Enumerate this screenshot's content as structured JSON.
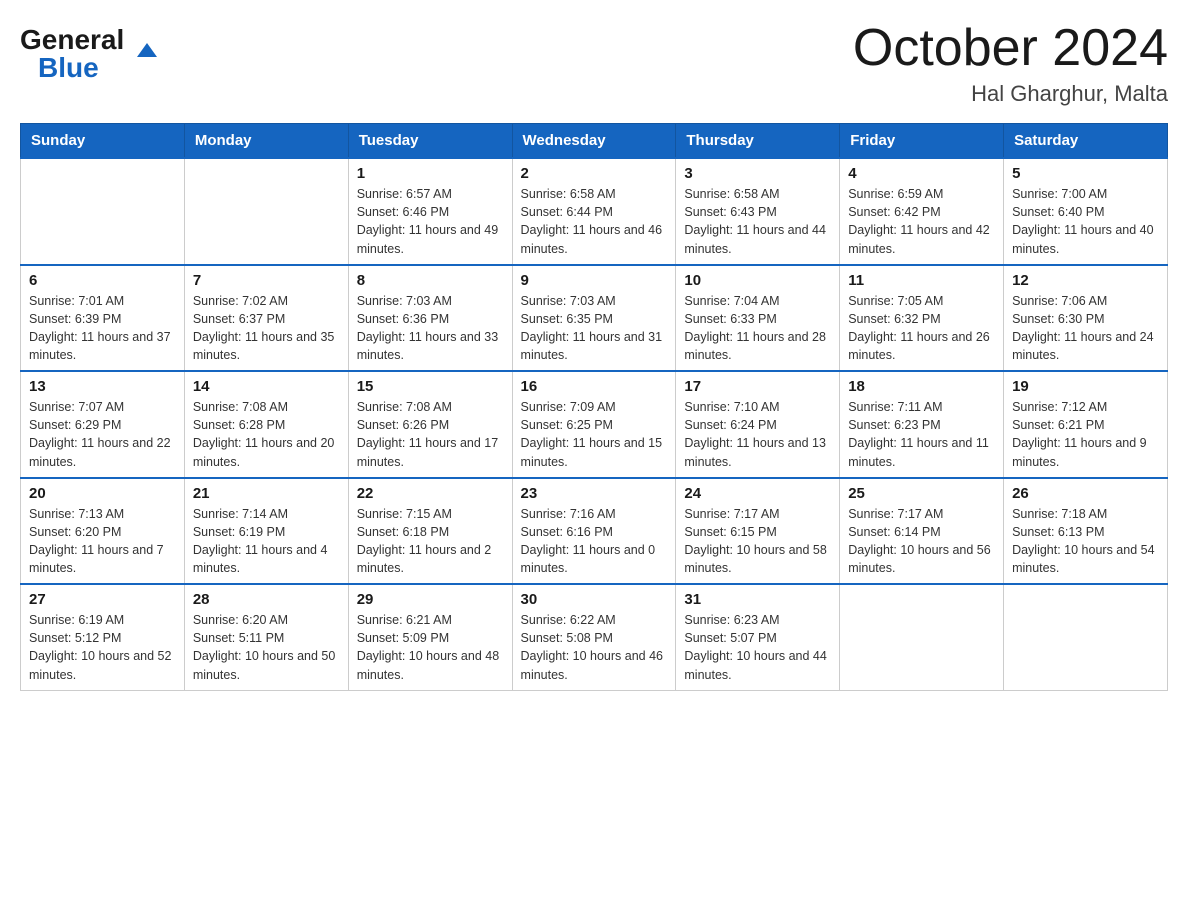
{
  "header": {
    "logo_general": "General",
    "logo_blue": "Blue",
    "month_year": "October 2024",
    "location": "Hal Gharghur, Malta"
  },
  "days_of_week": [
    "Sunday",
    "Monday",
    "Tuesday",
    "Wednesday",
    "Thursday",
    "Friday",
    "Saturday"
  ],
  "weeks": [
    [
      {
        "day": "",
        "sunrise": "",
        "sunset": "",
        "daylight": ""
      },
      {
        "day": "",
        "sunrise": "",
        "sunset": "",
        "daylight": ""
      },
      {
        "day": "1",
        "sunrise": "Sunrise: 6:57 AM",
        "sunset": "Sunset: 6:46 PM",
        "daylight": "Daylight: 11 hours and 49 minutes."
      },
      {
        "day": "2",
        "sunrise": "Sunrise: 6:58 AM",
        "sunset": "Sunset: 6:44 PM",
        "daylight": "Daylight: 11 hours and 46 minutes."
      },
      {
        "day": "3",
        "sunrise": "Sunrise: 6:58 AM",
        "sunset": "Sunset: 6:43 PM",
        "daylight": "Daylight: 11 hours and 44 minutes."
      },
      {
        "day": "4",
        "sunrise": "Sunrise: 6:59 AM",
        "sunset": "Sunset: 6:42 PM",
        "daylight": "Daylight: 11 hours and 42 minutes."
      },
      {
        "day": "5",
        "sunrise": "Sunrise: 7:00 AM",
        "sunset": "Sunset: 6:40 PM",
        "daylight": "Daylight: 11 hours and 40 minutes."
      }
    ],
    [
      {
        "day": "6",
        "sunrise": "Sunrise: 7:01 AM",
        "sunset": "Sunset: 6:39 PM",
        "daylight": "Daylight: 11 hours and 37 minutes."
      },
      {
        "day": "7",
        "sunrise": "Sunrise: 7:02 AM",
        "sunset": "Sunset: 6:37 PM",
        "daylight": "Daylight: 11 hours and 35 minutes."
      },
      {
        "day": "8",
        "sunrise": "Sunrise: 7:03 AM",
        "sunset": "Sunset: 6:36 PM",
        "daylight": "Daylight: 11 hours and 33 minutes."
      },
      {
        "day": "9",
        "sunrise": "Sunrise: 7:03 AM",
        "sunset": "Sunset: 6:35 PM",
        "daylight": "Daylight: 11 hours and 31 minutes."
      },
      {
        "day": "10",
        "sunrise": "Sunrise: 7:04 AM",
        "sunset": "Sunset: 6:33 PM",
        "daylight": "Daylight: 11 hours and 28 minutes."
      },
      {
        "day": "11",
        "sunrise": "Sunrise: 7:05 AM",
        "sunset": "Sunset: 6:32 PM",
        "daylight": "Daylight: 11 hours and 26 minutes."
      },
      {
        "day": "12",
        "sunrise": "Sunrise: 7:06 AM",
        "sunset": "Sunset: 6:30 PM",
        "daylight": "Daylight: 11 hours and 24 minutes."
      }
    ],
    [
      {
        "day": "13",
        "sunrise": "Sunrise: 7:07 AM",
        "sunset": "Sunset: 6:29 PM",
        "daylight": "Daylight: 11 hours and 22 minutes."
      },
      {
        "day": "14",
        "sunrise": "Sunrise: 7:08 AM",
        "sunset": "Sunset: 6:28 PM",
        "daylight": "Daylight: 11 hours and 20 minutes."
      },
      {
        "day": "15",
        "sunrise": "Sunrise: 7:08 AM",
        "sunset": "Sunset: 6:26 PM",
        "daylight": "Daylight: 11 hours and 17 minutes."
      },
      {
        "day": "16",
        "sunrise": "Sunrise: 7:09 AM",
        "sunset": "Sunset: 6:25 PM",
        "daylight": "Daylight: 11 hours and 15 minutes."
      },
      {
        "day": "17",
        "sunrise": "Sunrise: 7:10 AM",
        "sunset": "Sunset: 6:24 PM",
        "daylight": "Daylight: 11 hours and 13 minutes."
      },
      {
        "day": "18",
        "sunrise": "Sunrise: 7:11 AM",
        "sunset": "Sunset: 6:23 PM",
        "daylight": "Daylight: 11 hours and 11 minutes."
      },
      {
        "day": "19",
        "sunrise": "Sunrise: 7:12 AM",
        "sunset": "Sunset: 6:21 PM",
        "daylight": "Daylight: 11 hours and 9 minutes."
      }
    ],
    [
      {
        "day": "20",
        "sunrise": "Sunrise: 7:13 AM",
        "sunset": "Sunset: 6:20 PM",
        "daylight": "Daylight: 11 hours and 7 minutes."
      },
      {
        "day": "21",
        "sunrise": "Sunrise: 7:14 AM",
        "sunset": "Sunset: 6:19 PM",
        "daylight": "Daylight: 11 hours and 4 minutes."
      },
      {
        "day": "22",
        "sunrise": "Sunrise: 7:15 AM",
        "sunset": "Sunset: 6:18 PM",
        "daylight": "Daylight: 11 hours and 2 minutes."
      },
      {
        "day": "23",
        "sunrise": "Sunrise: 7:16 AM",
        "sunset": "Sunset: 6:16 PM",
        "daylight": "Daylight: 11 hours and 0 minutes."
      },
      {
        "day": "24",
        "sunrise": "Sunrise: 7:17 AM",
        "sunset": "Sunset: 6:15 PM",
        "daylight": "Daylight: 10 hours and 58 minutes."
      },
      {
        "day": "25",
        "sunrise": "Sunrise: 7:17 AM",
        "sunset": "Sunset: 6:14 PM",
        "daylight": "Daylight: 10 hours and 56 minutes."
      },
      {
        "day": "26",
        "sunrise": "Sunrise: 7:18 AM",
        "sunset": "Sunset: 6:13 PM",
        "daylight": "Daylight: 10 hours and 54 minutes."
      }
    ],
    [
      {
        "day": "27",
        "sunrise": "Sunrise: 6:19 AM",
        "sunset": "Sunset: 5:12 PM",
        "daylight": "Daylight: 10 hours and 52 minutes."
      },
      {
        "day": "28",
        "sunrise": "Sunrise: 6:20 AM",
        "sunset": "Sunset: 5:11 PM",
        "daylight": "Daylight: 10 hours and 50 minutes."
      },
      {
        "day": "29",
        "sunrise": "Sunrise: 6:21 AM",
        "sunset": "Sunset: 5:09 PM",
        "daylight": "Daylight: 10 hours and 48 minutes."
      },
      {
        "day": "30",
        "sunrise": "Sunrise: 6:22 AM",
        "sunset": "Sunset: 5:08 PM",
        "daylight": "Daylight: 10 hours and 46 minutes."
      },
      {
        "day": "31",
        "sunrise": "Sunrise: 6:23 AM",
        "sunset": "Sunset: 5:07 PM",
        "daylight": "Daylight: 10 hours and 44 minutes."
      },
      {
        "day": "",
        "sunrise": "",
        "sunset": "",
        "daylight": ""
      },
      {
        "day": "",
        "sunrise": "",
        "sunset": "",
        "daylight": ""
      }
    ]
  ]
}
